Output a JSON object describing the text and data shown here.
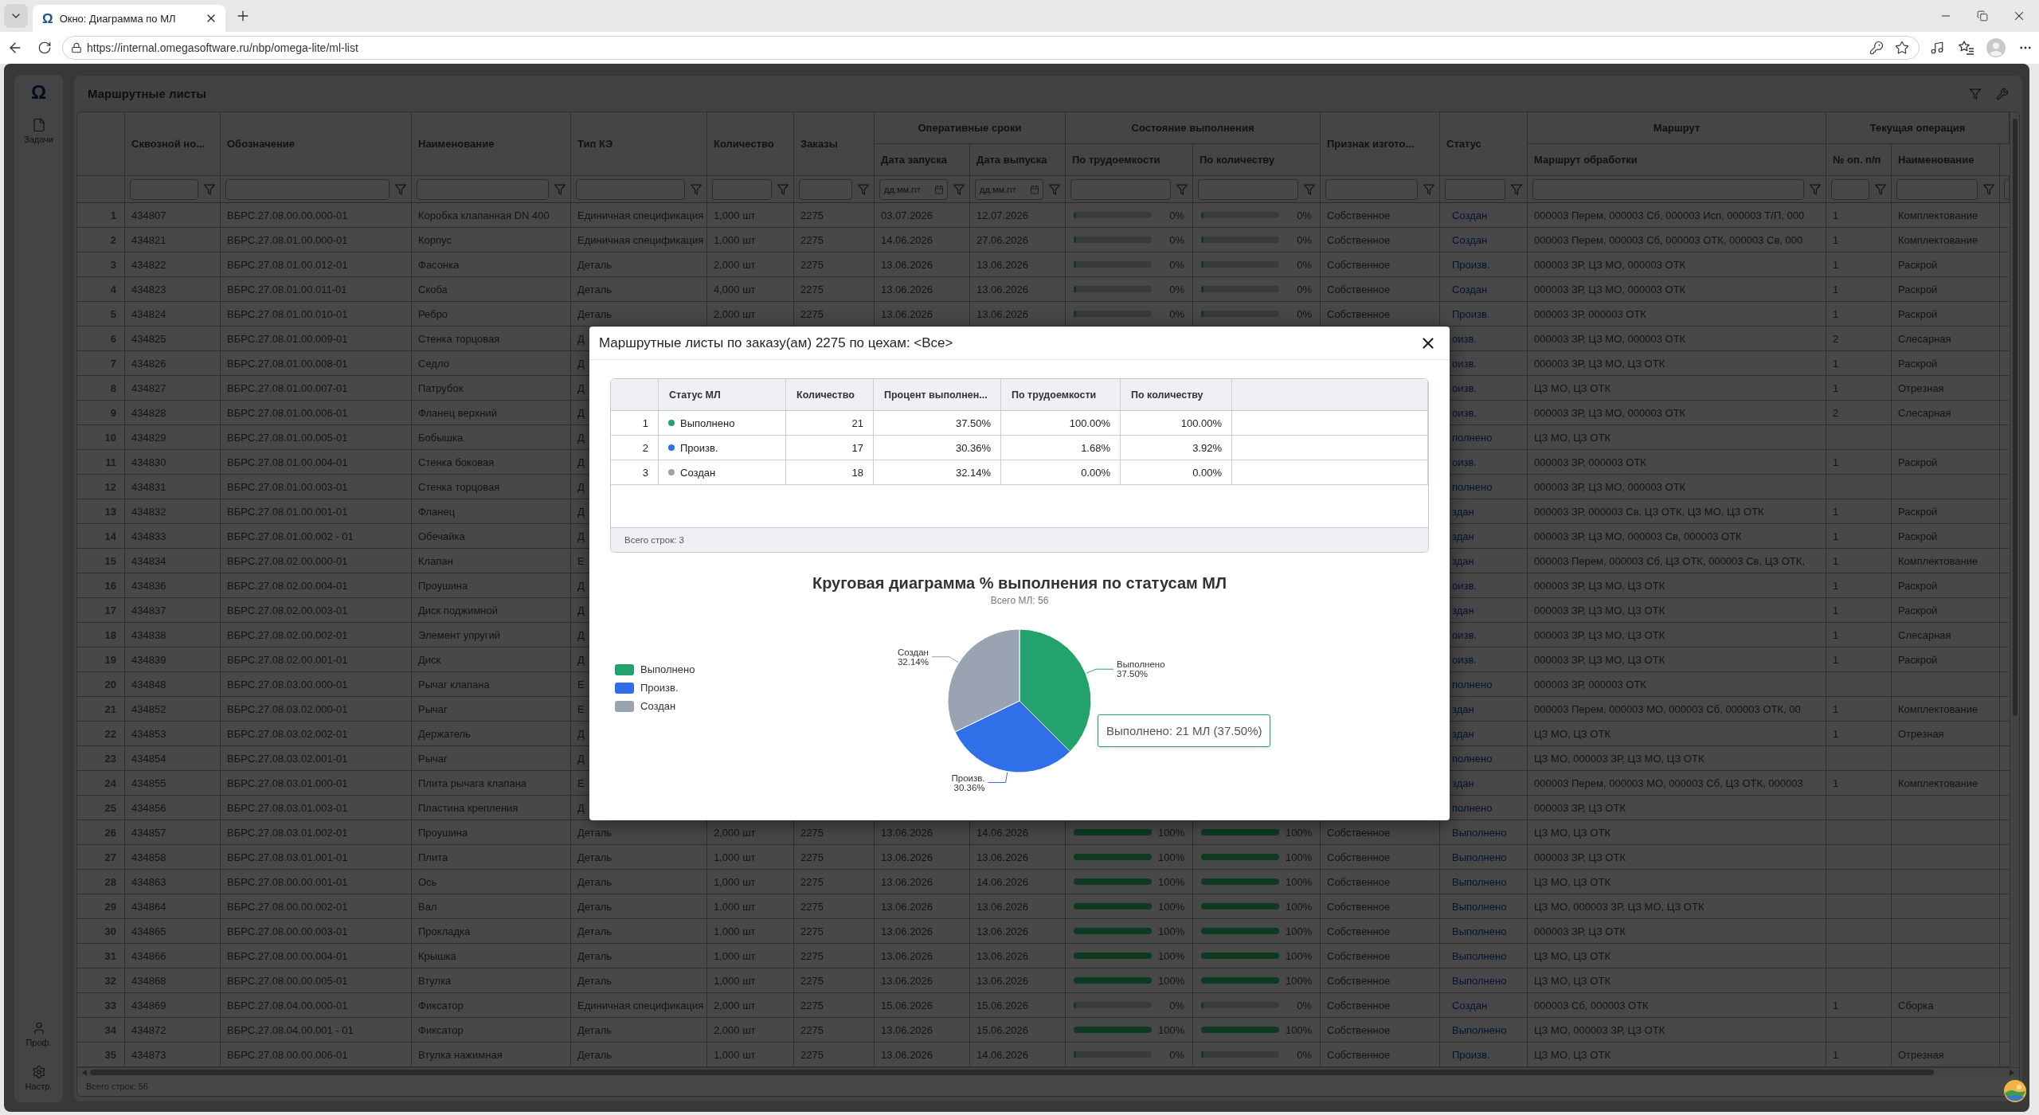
{
  "browser": {
    "tab": {
      "icon": "Ω",
      "title": "Окно: Диаграмма по МЛ"
    },
    "url": "https://internal.omegasoftware.ru/nbp/omega-lite/ml-list"
  },
  "sidebar": {
    "logo": "Ω",
    "items": [
      {
        "label": "Задачи",
        "kind": "tasks"
      }
    ],
    "footer_items": [
      {
        "label": "Проф.",
        "kind": "profile"
      },
      {
        "label": "Настр.",
        "kind": "settings"
      }
    ]
  },
  "page": {
    "title": "Маршрутные листы"
  },
  "table": {
    "header": [
      {
        "kind": "blank"
      },
      {
        "kind": "column",
        "label": "Сквозной но...",
        "filter": {
          "kind": "text"
        }
      },
      {
        "kind": "column",
        "label": "Обозначение",
        "filter": {
          "kind": "text"
        }
      },
      {
        "kind": "column",
        "label": "Наименование",
        "filter": {
          "kind": "text"
        }
      },
      {
        "kind": "column",
        "label": "Тип КЭ",
        "filter": {
          "kind": "text"
        }
      },
      {
        "kind": "column",
        "label": "Количество",
        "filter": {
          "kind": "text"
        }
      },
      {
        "kind": "column",
        "label": "Заказы",
        "filter": {
          "kind": "text"
        }
      },
      {
        "kind": "group",
        "label": "Оперативные сроки",
        "children": [
          {
            "label": "Дата запуска",
            "filter": {
              "kind": "date",
              "placeholder": "дд.мм.ггг"
            }
          },
          {
            "label": "Дата выпуска",
            "filter": {
              "kind": "date",
              "placeholder": "дд.мм.ггг"
            }
          }
        ]
      },
      {
        "kind": "group",
        "label": "Состояние выполнения",
        "children": [
          {
            "label": "По трудоемкости",
            "filter": {
              "kind": "text"
            }
          },
          {
            "label": "По количеству",
            "filter": {
              "kind": "text"
            }
          }
        ]
      },
      {
        "kind": "column",
        "label": "Признак изгото...",
        "filter": {
          "kind": "text"
        }
      },
      {
        "kind": "column",
        "label": "Статус",
        "filter": {
          "kind": "text"
        }
      },
      {
        "kind": "group",
        "label": "Маршрут",
        "children": [
          {
            "label": "Маршрут обработки",
            "filter": {
              "kind": "text"
            }
          }
        ]
      },
      {
        "kind": "group",
        "label": "Текущая операция",
        "children": [
          {
            "label": "№ оп. п/п",
            "filter": {
              "kind": "text"
            }
          },
          {
            "label": "Наименование",
            "filter": {
              "kind": "text"
            }
          },
          {
            "filter": {
              "kind": "text"
            }
          }
        ]
      }
    ],
    "rows": [
      {
        "n": "1",
        "id": "434807",
        "designation": "ВБРС.27.08.00.00.000-01",
        "name": "Коробка клапанная DN 400",
        "type": "Единичная спецификация",
        "quantity": "1,000 шт",
        "orders": "2275",
        "launch": "03.07.2026",
        "release": "12.07.2026",
        "by_labor": {
          "level": 0,
          "reading": "0%"
        },
        "by_quantity": {
          "level": 0,
          "reading": "0%"
        },
        "sign": "Собственное",
        "status": "Создан",
        "route": "000003 Перем, 000003 Сб, 000003 Исп, 000003 Т/П, 000",
        "op_no": "1",
        "op_name": "Комплектование"
      },
      {
        "n": "2",
        "id": "434821",
        "designation": "ВБРС.27.08.01.00.000-01",
        "name": "Корпус",
        "type": "Единичная спецификация",
        "quantity": "1,000 шт",
        "orders": "2275",
        "launch": "14.06.2026",
        "release": "27.06.2026",
        "by_labor": {
          "level": 0,
          "reading": "0%"
        },
        "by_quantity": {
          "level": 0,
          "reading": "0%"
        },
        "sign": "Собственное",
        "status": "Создан",
        "route": "000003 Перем, 000003 Сб, 000003 ОТК, 000003 Св, 000",
        "op_no": "1",
        "op_name": "Комплектование"
      },
      {
        "n": "3",
        "id": "434822",
        "designation": "ВБРС.27.08.01.00.012-01",
        "name": "Фасонка",
        "type": "Деталь",
        "quantity": "2,000 шт",
        "orders": "2275",
        "launch": "13.06.2026",
        "release": "13.06.2026",
        "by_labor": {
          "level": 0,
          "reading": "0%"
        },
        "by_quantity": {
          "level": 0,
          "reading": "0%"
        },
        "sign": "Собственное",
        "status": "Произв.",
        "route": "000003 ЗР, ЦЗ МО, 000003 ОТК",
        "op_no": "1",
        "op_name": "Раскрой"
      },
      {
        "n": "4",
        "id": "434823",
        "designation": "ВБРС.27.08.01.00.011-01",
        "name": "Скоба",
        "type": "Деталь",
        "quantity": "4,000 шт",
        "orders": "2275",
        "launch": "13.06.2026",
        "release": "13.06.2026",
        "by_labor": {
          "level": 0,
          "reading": "0%"
        },
        "by_quantity": {
          "level": 0,
          "reading": "0%"
        },
        "sign": "Собственное",
        "status": "Создан",
        "route": "000003 ЗР, ЦЗ МО, 000003 ОТК",
        "op_no": "1",
        "op_name": "Раскрой"
      },
      {
        "n": "5",
        "id": "434824",
        "designation": "ВБРС.27.08.01.00.010-01",
        "name": "Ребро",
        "type": "Деталь",
        "quantity": "2,000 шт",
        "orders": "2275",
        "launch": "13.06.2026",
        "release": "13.06.2026",
        "by_labor": {
          "level": 0,
          "reading": "0%"
        },
        "by_quantity": {
          "level": 0,
          "reading": "0%"
        },
        "sign": "Собственное",
        "status": "Произв.",
        "route": "000003 ЗР, 000003 ОТК",
        "op_no": "1",
        "op_name": "Раскрой"
      },
      {
        "n": "6",
        "id": "434825",
        "designation": "ВБРС.27.08.01.00.009-01",
        "name": "Стенка торцовая",
        "type": "Д",
        "status": "оизв.",
        "route": "000003 ЗР, ЦЗ МО, 000003 ОТК",
        "op_no": "2",
        "op_name": "Слесарная"
      },
      {
        "n": "7",
        "id": "434826",
        "designation": "ВБРС.27.08.01.00.008-01",
        "name": "Седло",
        "type": "Д",
        "status": "оизв.",
        "route": "000003 ЗР, ЦЗ МО, ЦЗ ОТК",
        "op_no": "1",
        "op_name": "Раскрой"
      },
      {
        "n": "8",
        "id": "434827",
        "designation": "ВБРС.27.08.01.00.007-01",
        "name": "Патрубок",
        "type": "Д",
        "status": "оизв.",
        "route": "ЦЗ МО, ЦЗ ОТК",
        "op_no": "1",
        "op_name": "Отрезная"
      },
      {
        "n": "9",
        "id": "434828",
        "designation": "ВБРС.27.08.01.00.006-01",
        "name": "Фланец верхний",
        "type": "Д",
        "status": "оизв.",
        "route": "000003 ЗР, ЦЗ МО, 000003 ОТК",
        "op_no": "2",
        "op_name": "Слесарная"
      },
      {
        "n": "10",
        "id": "434829",
        "designation": "ВБРС.27.08.01.00.005-01",
        "name": "Бобышка",
        "type": "Д",
        "status": "полнено",
        "route": "ЦЗ МО, ЦЗ ОТК"
      },
      {
        "n": "11",
        "id": "434830",
        "designation": "ВБРС.27.08.01.00.004-01",
        "name": "Стенка боковая",
        "type": "Д",
        "status": "оизв.",
        "route": "000003 ЗР, 000003 ОТК",
        "op_no": "1",
        "op_name": "Раскрой"
      },
      {
        "n": "12",
        "id": "434831",
        "designation": "ВБРС.27.08.01.00.003-01",
        "name": "Стенка торцовая",
        "type": "Д",
        "status": "полнено",
        "route": "000003 ЗР, ЦЗ МО, 000003 ОТК"
      },
      {
        "n": "13",
        "id": "434832",
        "designation": "ВБРС.27.08.01.00.001-01",
        "name": "Фланец",
        "type": "Д",
        "status": "здан",
        "route": "000003 ЗР, 000003 Св, ЦЗ ОТК, ЦЗ МО, ЦЗ ОТК",
        "op_no": "1",
        "op_name": "Раскрой"
      },
      {
        "n": "14",
        "id": "434833",
        "designation": "ВБРС.27.08.01.00.002 - 01",
        "name": "Обечайка",
        "type": "Д",
        "status": "здан",
        "route": "000003 ЗР, ЦЗ МО, 000003 Св, 000003 ОТК",
        "op_no": "1",
        "op_name": "Раскрой"
      },
      {
        "n": "15",
        "id": "434834",
        "designation": "ВБРС.27.08.02.00.000-01",
        "name": "Клапан",
        "type": "Е",
        "status": "здан",
        "route": "000003 Перем, 000003 Сб, ЦЗ ОТК, 000003 Св, ЦЗ ОТК,",
        "op_no": "1",
        "op_name": "Комплектование"
      },
      {
        "n": "16",
        "id": "434836",
        "designation": "ВБРС.27.08.02.00.004-01",
        "name": "Проушина",
        "type": "Д",
        "status": "оизв.",
        "route": "000003 ЗР, ЦЗ МО, ЦЗ ОТК",
        "op_no": "1",
        "op_name": "Раскрой"
      },
      {
        "n": "17",
        "id": "434837",
        "designation": "ВБРС.27.08.02.00.003-01",
        "name": "Диск поджимной",
        "type": "Д",
        "status": "здан",
        "route": "000003 ЗР, ЦЗ МО, ЦЗ ОТК",
        "op_no": "1",
        "op_name": "Раскрой"
      },
      {
        "n": "18",
        "id": "434838",
        "designation": "ВБРС.27.08.02.00.002-01",
        "name": "Элемент упругий",
        "type": "Д",
        "status": "оизв.",
        "route": "000003 ЗР, ЦЗ МО, ЦЗ ОТК",
        "op_no": "1",
        "op_name": "Слесарная"
      },
      {
        "n": "19",
        "id": "434839",
        "designation": "ВБРС.27.08.02.00.001-01",
        "name": "Диск",
        "type": "Д",
        "status": "оизв.",
        "route": "000003 ЗР, ЦЗ МО, ЦЗ ОТК",
        "op_no": "1",
        "op_name": "Раскрой"
      },
      {
        "n": "20",
        "id": "434848",
        "designation": "ВБРС.27.08.03.00.000-01",
        "name": "Рычаг клапана",
        "type": "Е",
        "status": "полнено",
        "route": "000003 ЗР, 000003 ОТК"
      },
      {
        "n": "21",
        "id": "434852",
        "designation": "ВБРС.27.08.03.02.000-01",
        "name": "Рычаг",
        "type": "Е",
        "status": "здан",
        "route": "000003 Перем, 000003 МО, 000003 Сб, 000003 ОТК, 00",
        "op_no": "1",
        "op_name": "Комплектование"
      },
      {
        "n": "22",
        "id": "434853",
        "designation": "ВБРС.27.08.03.02.002-01",
        "name": "Держатель",
        "type": "Д",
        "status": "здан",
        "route": "ЦЗ МО, ЦЗ ОТК",
        "op_no": "1",
        "op_name": "Отрезная"
      },
      {
        "n": "23",
        "id": "434854",
        "designation": "ВБРС.27.08.03.02.001-01",
        "name": "Рычаг",
        "type": "Д",
        "status": "полнено",
        "route": "ЦЗ МО, 000003 ЗР, ЦЗ МО, ЦЗ ОТК"
      },
      {
        "n": "24",
        "id": "434855",
        "designation": "ВБРС.27.08.03.01.000-01",
        "name": "Плита рычага клапана",
        "type": "Е",
        "status": "здан",
        "route": "000003 Перем, 000003 МО, 000003 Сб, ЦЗ ОТК, 000003",
        "op_no": "1",
        "op_name": "Комплектование"
      },
      {
        "n": "25",
        "id": "434856",
        "designation": "ВБРС.27.08.03.01.003-01",
        "name": "Пластина крепления",
        "type": "Д",
        "status": "полнено",
        "route": "000003 ЗР, ЦЗ ОТК"
      },
      {
        "n": "26",
        "id": "434857",
        "designation": "ВБРС.27.08.03.01.002-01",
        "name": "Проушина",
        "type": "Деталь",
        "quantity": "2,000 шт",
        "orders": "2275",
        "launch": "13.06.2026",
        "release": "14.06.2026",
        "by_labor": {
          "level": 1,
          "reading": "100%"
        },
        "by_quantity": {
          "level": 1,
          "reading": "100%"
        },
        "sign": "Собственное",
        "status": "Выполнено",
        "route": "ЦЗ МО, ЦЗ ОТК"
      },
      {
        "n": "27",
        "id": "434858",
        "designation": "ВБРС.27.08.03.01.001-01",
        "name": "Плита",
        "type": "Деталь",
        "quantity": "1,000 шт",
        "orders": "2275",
        "launch": "13.06.2026",
        "release": "13.06.2026",
        "by_labor": {
          "level": 1,
          "reading": "100%"
        },
        "by_quantity": {
          "level": 1,
          "reading": "100%"
        },
        "sign": "Собственное",
        "status": "Выполнено",
        "route": "000003 ЗР, ЦЗ ОТК"
      },
      {
        "n": "28",
        "id": "434863",
        "designation": "ВБРС.27.08.00.00.001-01",
        "name": "Ось",
        "type": "Деталь",
        "quantity": "1,000 шт",
        "orders": "2275",
        "launch": "13.06.2026",
        "release": "14.06.2026",
        "by_labor": {
          "level": 1,
          "reading": "100%"
        },
        "by_quantity": {
          "level": 1,
          "reading": "100%"
        },
        "sign": "Собственное",
        "status": "Выполнено",
        "route": "ЦЗ МО, ЦЗ ОТК"
      },
      {
        "n": "29",
        "id": "434864",
        "designation": "ВБРС.27.08.00.00.002-01",
        "name": "Вал",
        "type": "Деталь",
        "quantity": "1,000 шт",
        "orders": "2275",
        "launch": "13.06.2026",
        "release": "13.06.2026",
        "by_labor": {
          "level": 1,
          "reading": "100%"
        },
        "by_quantity": {
          "level": 1,
          "reading": "100%"
        },
        "sign": "Собственное",
        "status": "Выполнено",
        "route": "ЦЗ МО, 000003 ЗР, ЦЗ МО, ЦЗ ОТК"
      },
      {
        "n": "30",
        "id": "434865",
        "designation": "ВБРС.27.08.00.00.003-01",
        "name": "Прокладка",
        "type": "Деталь",
        "quantity": "1,000 шт",
        "orders": "2275",
        "launch": "13.06.2026",
        "release": "13.06.2026",
        "by_labor": {
          "level": 1,
          "reading": "100%"
        },
        "by_quantity": {
          "level": 1,
          "reading": "100%"
        },
        "sign": "Собственное",
        "status": "Выполнено",
        "route": "000003 ЗР, ЦЗ ОТК"
      },
      {
        "n": "31",
        "id": "434866",
        "designation": "ВБРС.27.08.00.00.004-01",
        "name": "Крышка",
        "type": "Деталь",
        "quantity": "1,000 шт",
        "orders": "2275",
        "launch": "13.06.2026",
        "release": "13.06.2026",
        "by_labor": {
          "level": 1,
          "reading": "100%"
        },
        "by_quantity": {
          "level": 1,
          "reading": "100%"
        },
        "sign": "Собственное",
        "status": "Выполнено",
        "route": "ЦЗ МО, ЦЗ ОТК"
      },
      {
        "n": "32",
        "id": "434868",
        "designation": "ВБРС.27.08.00.00.005-01",
        "name": "Втулка",
        "type": "Деталь",
        "quantity": "1,000 шт",
        "orders": "2275",
        "launch": "13.06.2026",
        "release": "13.06.2026",
        "by_labor": {
          "level": 1,
          "reading": "100%"
        },
        "by_quantity": {
          "level": 1,
          "reading": "100%"
        },
        "sign": "Собственное",
        "status": "Выполнено",
        "route": "ЦЗ МО, ЦЗ ОТК"
      },
      {
        "n": "33",
        "id": "434869",
        "designation": "ВБРС.27.08.04.00.000-01",
        "name": "Фиксатор",
        "type": "Единичная спецификация",
        "quantity": "2,000 шт",
        "orders": "2275",
        "launch": "15.06.2026",
        "release": "15.06.2026",
        "by_labor": {
          "level": 0,
          "reading": "0%"
        },
        "by_quantity": {
          "level": 0,
          "reading": "0%"
        },
        "sign": "Собственное",
        "status": "Создан",
        "route": "000003 Сб, 000003 ОТК",
        "op_no": "1",
        "op_name": "Сборка"
      },
      {
        "n": "34",
        "id": "434872",
        "designation": "ВБРС.27.08.04.00.001 - 01",
        "name": "Фиксатор",
        "type": "Деталь",
        "quantity": "2,000 шт",
        "orders": "2275",
        "launch": "13.06.2026",
        "release": "15.06.2026",
        "by_labor": {
          "level": 1,
          "reading": "100%"
        },
        "by_quantity": {
          "level": 1,
          "reading": "100%"
        },
        "sign": "Собственное",
        "status": "Выполнено",
        "route": "ЦЗ МО, 000003 ЗР, ЦЗ ОТК"
      },
      {
        "n": "35",
        "id": "434873",
        "designation": "ВБРС.27.08.00.00.006-01",
        "name": "Втулка нажимная",
        "type": "Деталь",
        "quantity": "1,000 шт",
        "orders": "2275",
        "launch": "13.06.2026",
        "release": "14.06.2026",
        "by_labor": {
          "level": 0,
          "reading": "0%"
        },
        "by_quantity": {
          "level": 0,
          "reading": "0%"
        },
        "sign": "Собственное",
        "status": "Произв.",
        "route": "ЦЗ МО, ЦЗ ОТК",
        "op_no": "1",
        "op_name": "Отрезная"
      }
    ],
    "footer": "Всего строк: 56"
  },
  "modal": {
    "title": "Маршрутные листы по заказу(ам) 2275 по цехам: <Все>",
    "table": {
      "columns": [
        "Статус МЛ",
        "Количество",
        "Процент выполнен...",
        "По трудоемкости",
        "По количеству"
      ],
      "rows": [
        {
          "n": "1",
          "status": "Выполнено",
          "color": "#23a26d",
          "count": "21",
          "percent": "37.50%",
          "by_labor": "100.00%",
          "by_quantity": "100.00%"
        },
        {
          "n": "2",
          "status": "Произв.",
          "color": "#2f6fe8",
          "count": "17",
          "percent": "30.36%",
          "by_labor": "1.68%",
          "by_quantity": "3.92%"
        },
        {
          "n": "3",
          "status": "Создан",
          "color": "#9aa3b1",
          "count": "18",
          "percent": "32.14%",
          "by_labor": "0.00%",
          "by_quantity": "0.00%"
        }
      ],
      "footer": "Всего строк: 3"
    },
    "chart": {
      "subtitle": "Всего МЛ: 56",
      "legend": [
        {
          "label": "Выполнено",
          "color": "#23a26d"
        },
        {
          "label": "Произв.",
          "color": "#2f6fe8"
        },
        {
          "label": "Создан",
          "color": "#9aa3b1"
        }
      ],
      "tooltip": "Выполнено: 21 МЛ (37.50%)",
      "chart_data": {
        "type": "pie",
        "title": "Круговая диаграмма % выполнения по статусам МЛ",
        "categories": [
          "Выполнено",
          "Произв.",
          "Создан"
        ],
        "values": [
          37.5,
          30.36,
          32.14
        ],
        "value_labels": [
          "37.50%",
          "30.36%",
          "32.14%"
        ]
      }
    }
  }
}
